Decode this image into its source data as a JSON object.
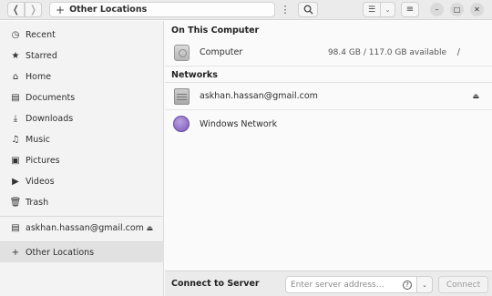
{
  "header": {
    "back_glyph": "❬",
    "forward_glyph": "❭",
    "location_prefix": "+",
    "location": "Other Locations",
    "menu_glyph": "⋮",
    "view_glyph": "☰",
    "dropdown_glyph": "⌄",
    "hamburger_glyph": "≡",
    "minimize_glyph": "–",
    "maximize_glyph": "□",
    "close_glyph": "✕"
  },
  "sidebar": {
    "items": [
      {
        "label": "Recent",
        "icon": "clock-icon",
        "glyph": "◷"
      },
      {
        "label": "Starred",
        "icon": "star-icon",
        "glyph": "★"
      },
      {
        "label": "Home",
        "icon": "home-icon",
        "glyph": "⌂"
      },
      {
        "label": "Documents",
        "icon": "document-icon",
        "glyph": "▤"
      },
      {
        "label": "Downloads",
        "icon": "download-icon",
        "glyph": "⤓"
      },
      {
        "label": "Music",
        "icon": "music-icon",
        "glyph": "♫"
      },
      {
        "label": "Pictures",
        "icon": "picture-icon",
        "glyph": "▣"
      },
      {
        "label": "Videos",
        "icon": "video-icon",
        "glyph": "▶"
      },
      {
        "label": "Trash",
        "icon": "trash-icon",
        "glyph": "🗑"
      }
    ],
    "mount": {
      "label": "askhan.hassan@gmail.com",
      "icon": "network-drive-icon",
      "glyph": "▤",
      "eject_glyph": "⏏"
    },
    "other": {
      "label": "Other Locations",
      "icon": "plus-icon",
      "glyph": "+"
    }
  },
  "main": {
    "this_computer_title": "On This Computer",
    "computer": {
      "name": "Computer",
      "usage": "98.4 GB / 117.0 GB available",
      "path": "/"
    },
    "networks_title": "Networks",
    "network_items": [
      {
        "name": "askhan.hassan@gmail.com",
        "icon": "network-drive-icon",
        "eject_glyph": "⏏"
      },
      {
        "name": "Windows Network",
        "icon": "globe-icon"
      }
    ]
  },
  "connect": {
    "label": "Connect to Server",
    "placeholder": "Enter server address…",
    "help_glyph": "?",
    "dropdown_glyph": "⌄",
    "button": "Connect"
  },
  "colors": {
    "selected_bg": "#e1e1e1",
    "network_globe": "#7a56bb"
  }
}
